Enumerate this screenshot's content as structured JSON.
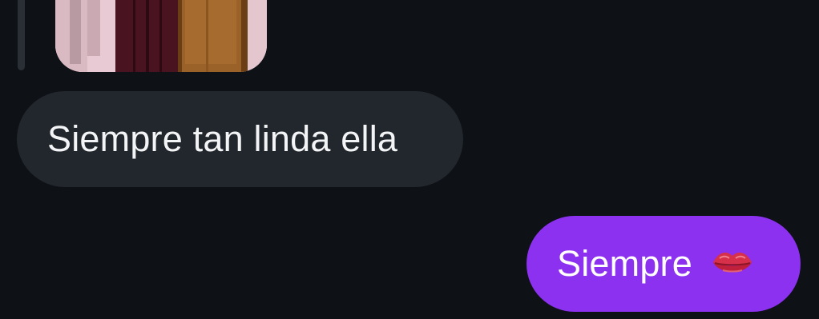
{
  "conversation": {
    "media": {
      "icon": "photo-thumbnail"
    },
    "messages": [
      {
        "direction": "incoming",
        "text": "Siempre tan linda ella",
        "bubble_color": "#22272d"
      },
      {
        "direction": "outgoing",
        "text": "Siempre",
        "emoji_icon": "kiss-mark-icon",
        "bubble_color": "#8c31f0"
      }
    ]
  },
  "colors": {
    "background": "#0e1116",
    "incoming_bubble": "#22272d",
    "outgoing_bubble": "#8c31f0"
  }
}
